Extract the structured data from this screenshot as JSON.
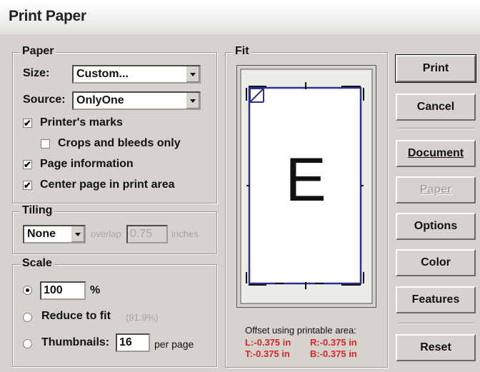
{
  "window": {
    "title": "Print Paper"
  },
  "paper": {
    "legend": "Paper",
    "size_label": "Size:",
    "size_value": "Custom...",
    "source_label": "Source:",
    "source_value": "OnlyOne",
    "printers_marks": {
      "label": "Printer's marks",
      "checked": true
    },
    "crops_bleeds": {
      "label": "Crops and bleeds only",
      "checked": false
    },
    "page_information": {
      "label": "Page information",
      "checked": true
    },
    "center_page": {
      "label": "Center page in print area",
      "checked": true
    }
  },
  "tiling": {
    "legend": "Tiling",
    "mode_value": "None",
    "overlap_label": "overlap",
    "overlap_value": "0.75",
    "units_label": "inches"
  },
  "scale": {
    "legend": "Scale",
    "percent_value": "100",
    "percent_unit": "%",
    "reduce_label": "Reduce to fit",
    "reduce_percent": "(91.9%)",
    "thumbnails_label": "Thumbnails:",
    "thumbnails_value": "16",
    "per_page_label": "per page",
    "selected": "percent"
  },
  "fit": {
    "legend": "Fit",
    "preview_letter": "E",
    "offset_title": "Offset using printable area:",
    "left": "L:-0.375 in",
    "right": "R:-0.375 in",
    "top": "T:-0.375 in",
    "bottom": "B:-0.375 in"
  },
  "buttons": {
    "print": "Print",
    "cancel": "Cancel",
    "document": "Document",
    "paper": "Paper",
    "options": "Options",
    "color": "Color",
    "features": "Features",
    "reset": "Reset"
  },
  "colors": {
    "dialog_bg": "#d6d3ce",
    "page_outline": "#2b2f8f",
    "offset_text": "#d8262b"
  }
}
